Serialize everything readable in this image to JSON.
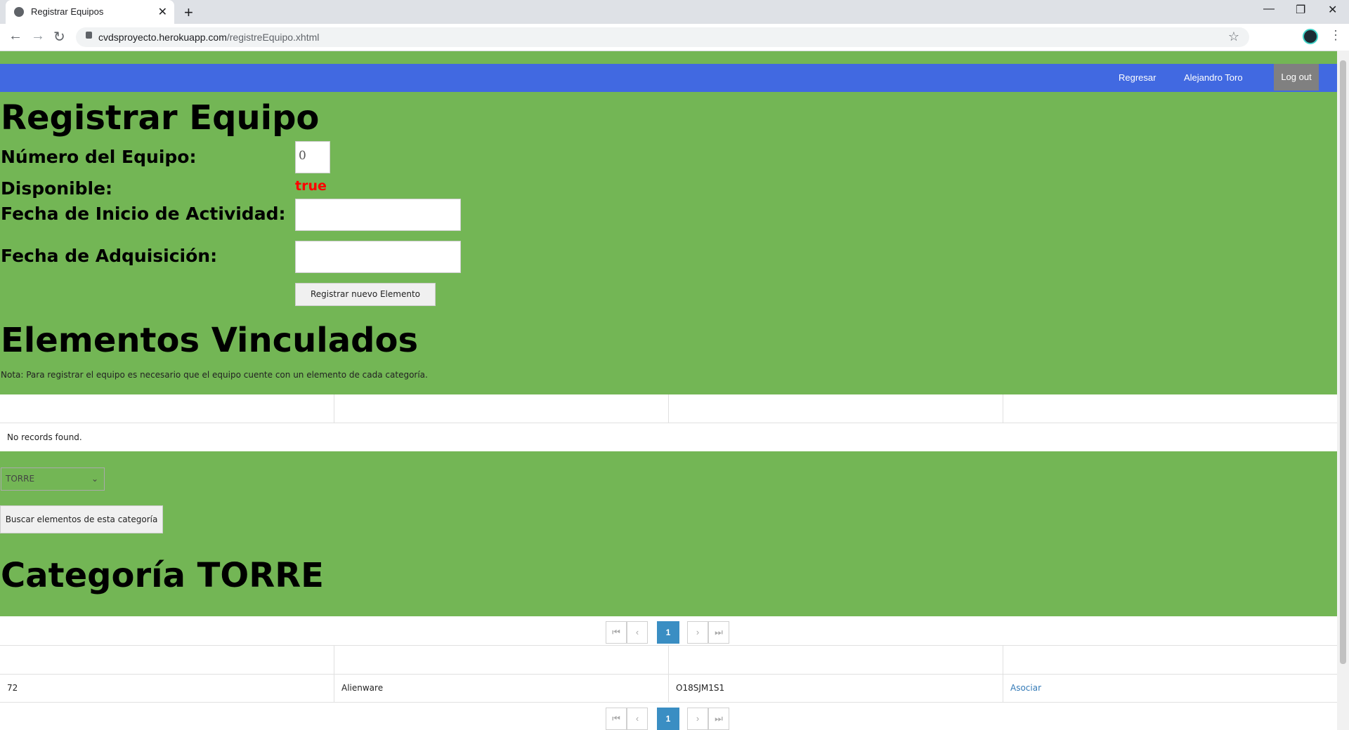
{
  "browser": {
    "tab_title": "Registrar Equipos",
    "url_host": "cvdsproyecto.herokuapp.com",
    "url_path": "/registreEquipo.xhtml"
  },
  "navbar": {
    "back_link": "Regresar",
    "user_name": "Alejandro Toro",
    "logout": "Log out"
  },
  "form": {
    "title": "Registrar Equipo",
    "numero_label": "Número del Equipo:",
    "numero_value": "0",
    "disponible_label": "Disponible:",
    "disponible_value": "true",
    "fecha_inicio_label": "Fecha de Inicio de Actividad:",
    "fecha_inicio_value": "",
    "fecha_adq_label": "Fecha de Adquisición:",
    "fecha_adq_value": "",
    "register_button": "Registrar nuevo Elemento"
  },
  "linked": {
    "title": "Elementos Vinculados",
    "note": "Nota: Para registrar el equipo es necesario que el equipo cuente con un elemento de cada categoría.",
    "empty_message": "No records found."
  },
  "category_select": {
    "selected": "TORRE",
    "search_button": "Buscar elementos de esta categoría"
  },
  "category_table": {
    "title": "Categoría TORRE",
    "page": "1",
    "rows": [
      {
        "id": "72",
        "name": "Alienware",
        "serial": "O18SJM1S1",
        "action": "Asociar"
      }
    ]
  }
}
